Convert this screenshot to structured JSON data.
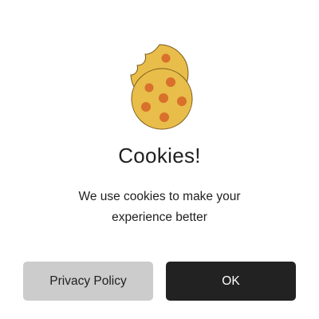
{
  "dialog": {
    "icon": "cookie-icon",
    "title": "Cookies!",
    "message_lines": [
      "We use cookies to make your",
      "experience better"
    ],
    "buttons": {
      "privacy_label": "Privacy Policy",
      "ok_label": "OK"
    }
  },
  "colors": {
    "cookie_fill": "#e8bd4a",
    "cookie_outline": "#7a5a1a",
    "chips": "#d9702b",
    "primary_button": "#222222",
    "secondary_button": "#cccccc",
    "text": "#1f1f1f"
  }
}
